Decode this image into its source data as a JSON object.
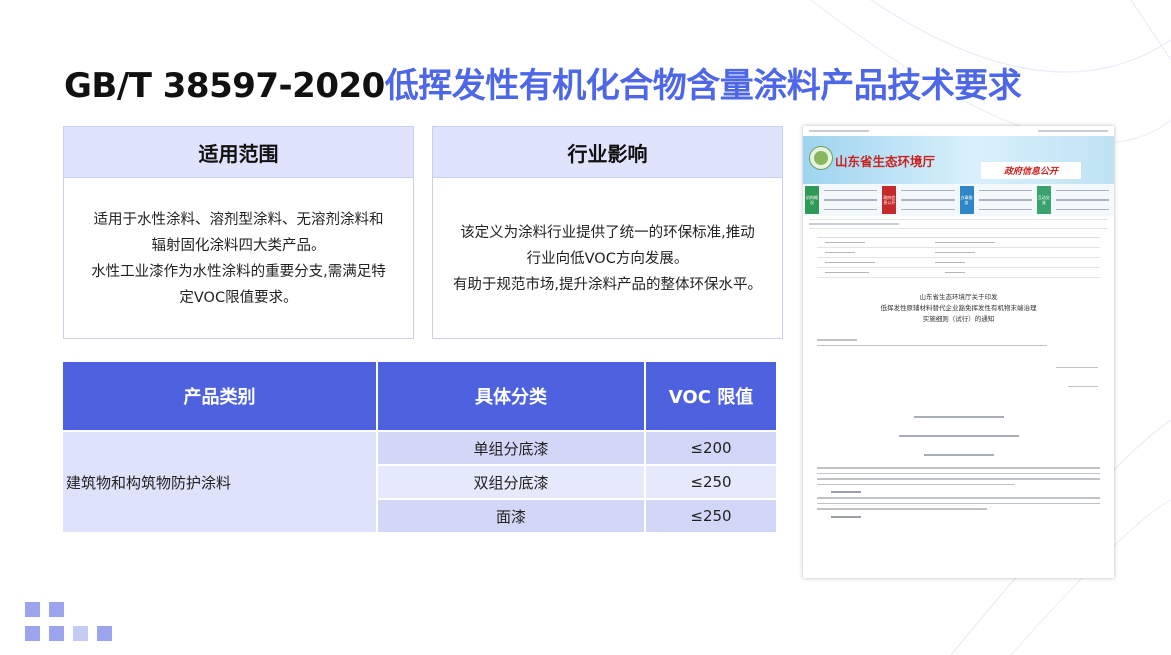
{
  "title": {
    "code": "GB/T 38597-2020",
    "name": "低挥发性有机化合物含量涂料产品技术要求"
  },
  "cards": {
    "scope": {
      "heading": "适用范围",
      "lines": [
        "适用于水性涂料、溶剂型涂料、无溶剂涂料和",
        "辐射固化涂料四大类产品。",
        "水性工业漆作为水性涂料的重要分支,需满足特",
        "定VOC限值要求。"
      ]
    },
    "impact": {
      "heading": "行业影响",
      "lines": [
        "该定义为涂料行业提供了统一的环保标准,推动",
        "行业向低VOC方向发展。",
        "有助于规范市场,提升涂料产品的整体环保水平。"
      ]
    }
  },
  "table": {
    "headers": [
      "产品类别",
      "具体分类",
      "VOC 限值"
    ],
    "category": "建筑物和构筑物防护涂料",
    "rows": [
      {
        "sub": "单组分底漆",
        "voc": "≤200"
      },
      {
        "sub": "双组分底漆",
        "voc": "≤250"
      },
      {
        "sub": "面漆",
        "voc": "≤250"
      }
    ]
  },
  "screenshot": {
    "site_name": "山东省生态环境厅",
    "banner_text": "政府信息公开",
    "nav_blocks": [
      "机构概况",
      "政府信息公开",
      "办事服务",
      "互动交流"
    ],
    "doc_heading": [
      "山东省生态环境厅关于印发",
      "低挥发性原辅材料替代企业豁免挥发性有机物末端治理",
      "实施细则（试行）的通知"
    ]
  },
  "colors": {
    "accent": "#4e67e6",
    "table_header": "#4e62e0",
    "card_header": "#dfe3fb",
    "site_red": "#c9231f"
  }
}
